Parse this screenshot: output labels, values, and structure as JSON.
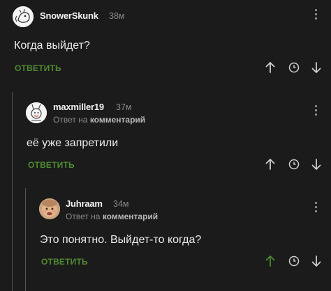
{
  "comments": [
    {
      "username": "SnowerSkunk",
      "time": "38м",
      "text": "Когда выйдет?",
      "reply_label": "ОТВЕТИТЬ"
    },
    {
      "username": "maxmiller19",
      "time": "37м",
      "reply_to_prefix": "Ответ на",
      "reply_to_target": "комментарий",
      "text": "её уже запретили",
      "reply_label": "ОТВЕТИТЬ"
    },
    {
      "username": "Juhraam",
      "time": "34м",
      "reply_to_prefix": "Ответ на",
      "reply_to_target": "комментарий",
      "text": "Это понятно. Выйдет-то когда?",
      "reply_label": "ОТВЕТИТЬ",
      "upvoted": true
    }
  ],
  "colors": {
    "background": "#1b1b1b",
    "accent_green": "#4f8b2f",
    "muted": "#8a8a8a"
  },
  "icons": [
    "more-menu-icon",
    "upvote-arrow-icon",
    "save-clock-icon",
    "downvote-arrow-icon"
  ]
}
